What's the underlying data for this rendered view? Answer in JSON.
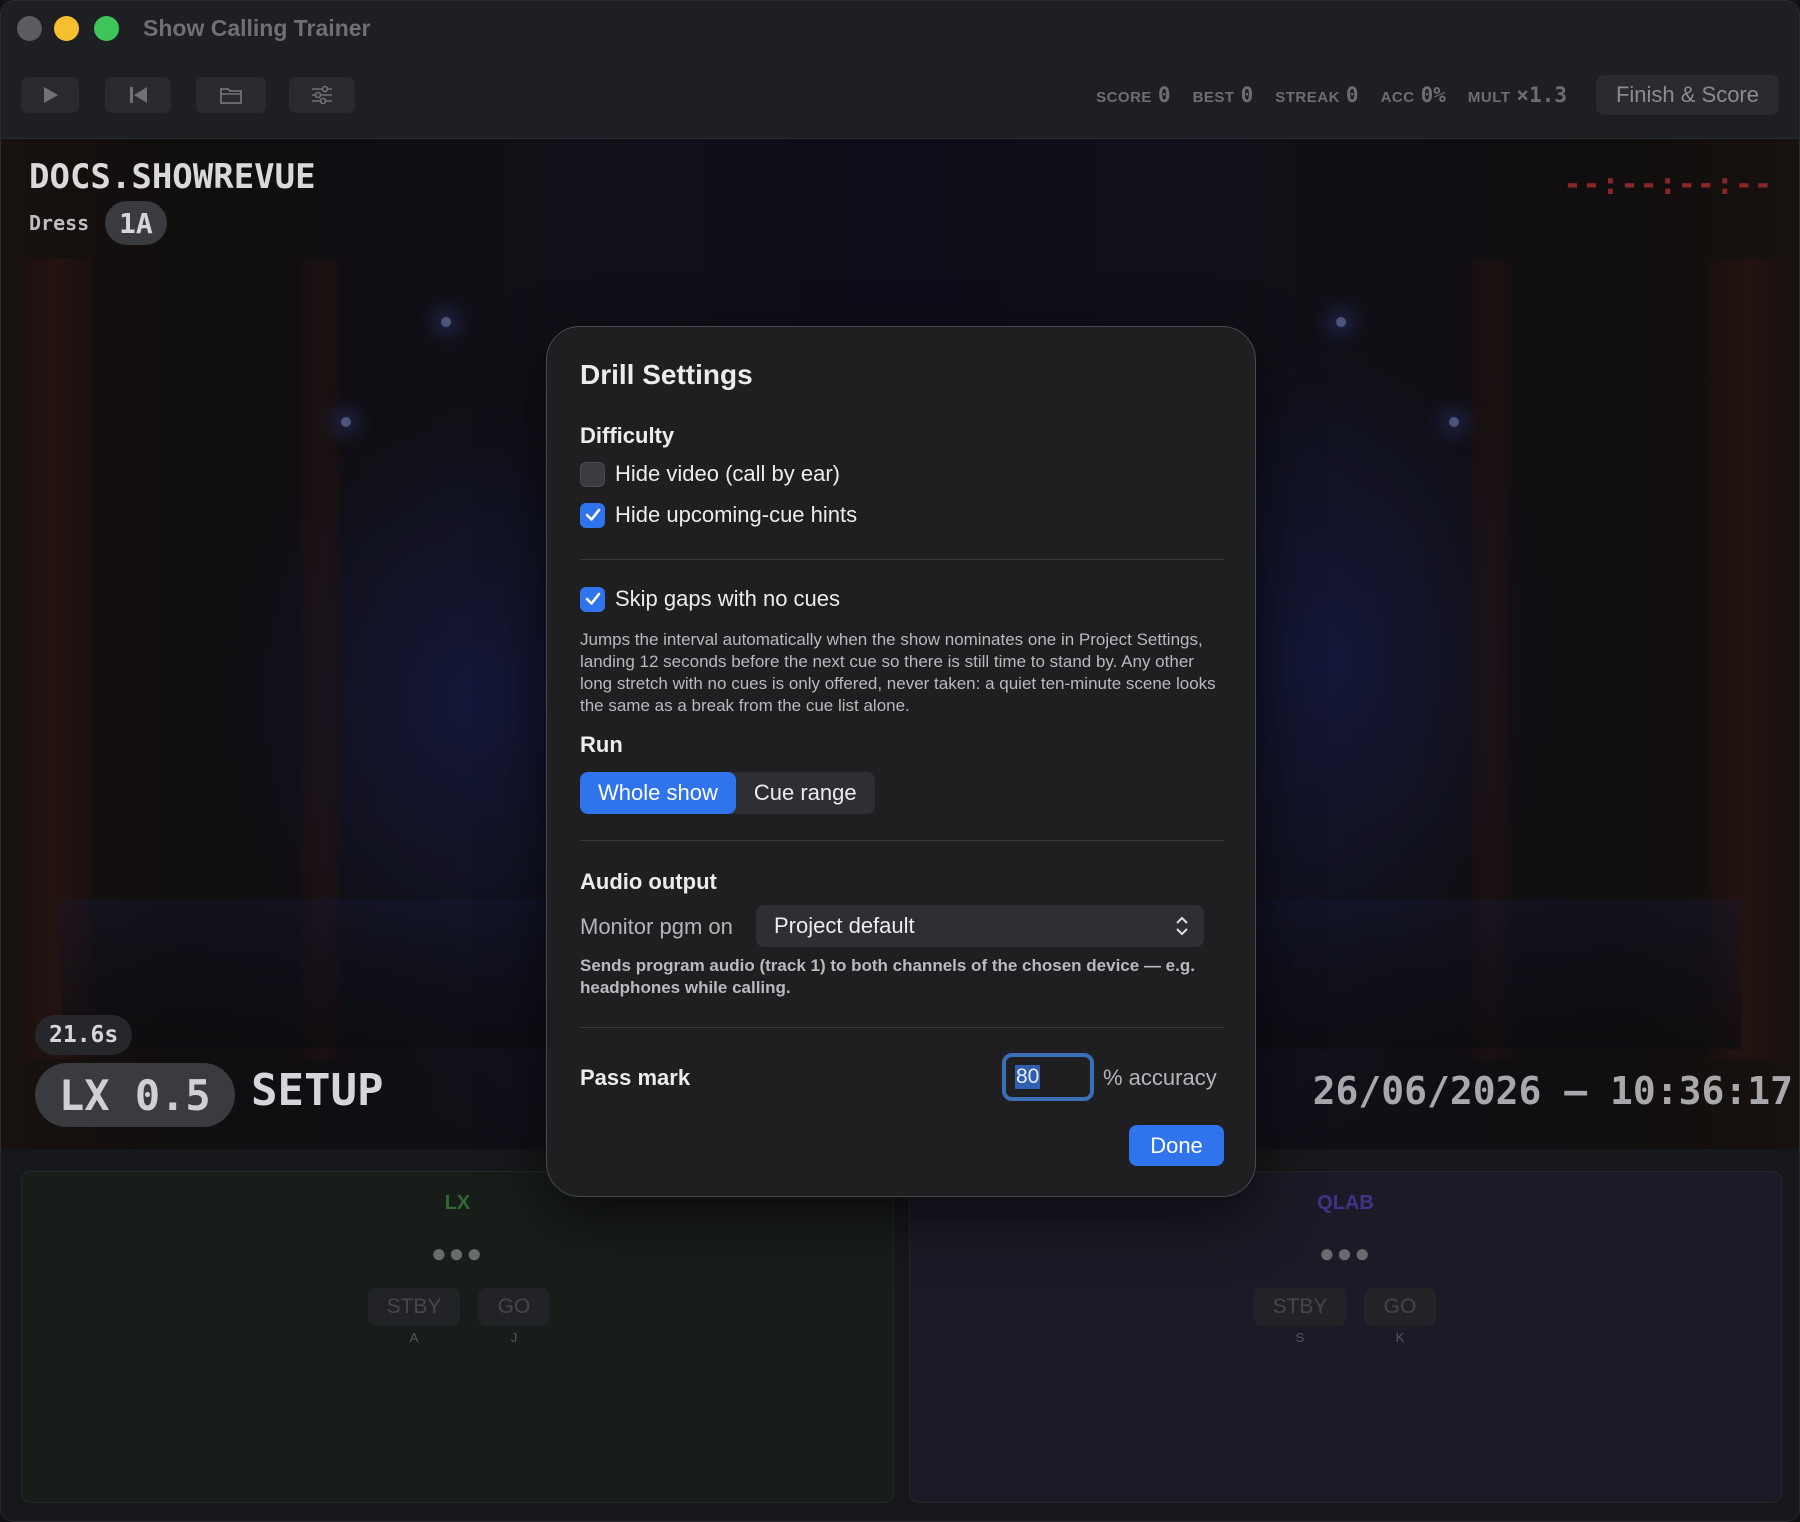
{
  "window": {
    "title": "Show Calling Trainer"
  },
  "toolbar": {
    "buttons": [
      "play-icon",
      "skip-back-icon",
      "folder-icon",
      "sliders-icon"
    ],
    "stats": [
      {
        "label": "SCORE",
        "value": "0"
      },
      {
        "label": "BEST",
        "value": "0"
      },
      {
        "label": "STREAK",
        "value": "0"
      },
      {
        "label": "ACC",
        "value": "0%"
      },
      {
        "label": "MULT",
        "value": "×1.3"
      }
    ],
    "finish_label": "Finish & Score"
  },
  "stage": {
    "show_name": "DOCS.SHOWREVUE",
    "run_type": "Dress",
    "scene": "1A",
    "timecode": "--:--:--:--",
    "elapsed": "21.6s",
    "current_cue": "LX 0.5",
    "cue_name": "SETUP",
    "clock": "26/06/2026 – 10:36:17"
  },
  "panels": [
    {
      "title": "LX",
      "dots": "●●●",
      "stby": "STBY",
      "go": "GO",
      "stby_key": "A",
      "go_key": "J"
    },
    {
      "title": "QLAB",
      "dots": "●●●",
      "stby": "STBY",
      "go": "GO",
      "stby_key": "S",
      "go_key": "K"
    }
  ],
  "modal": {
    "title": "Drill Settings",
    "difficulty_heading": "Difficulty",
    "hide_video": {
      "label": "Hide video (call by ear)",
      "checked": false
    },
    "hide_hints": {
      "label": "Hide upcoming-cue hints",
      "checked": true
    },
    "skip_gaps": {
      "label": "Skip gaps with no cues",
      "checked": true
    },
    "skip_gaps_help": "Jumps the interval automatically when the show nominates one in Project Settings, landing 12 seconds before the next cue so there is still time to stand by. Any other long stretch with no cues is only offered, never taken: a quiet ten-minute scene looks the same as a break from the cue list alone.",
    "run_heading": "Run",
    "run_options": [
      "Whole show",
      "Cue range"
    ],
    "run_selected": "Whole show",
    "audio_heading": "Audio output",
    "monitor_label": "Monitor pgm on",
    "monitor_value": "Project default",
    "audio_help": "Sends program audio (track 1) to both channels of the chosen device — e.g. headphones while calling.",
    "pass_label": "Pass mark",
    "pass_value": "80",
    "pass_suffix": "% accuracy",
    "done_label": "Done"
  },
  "colors": {
    "accent": "#2f74ec",
    "lx": "#2f6a34",
    "qlab": "#3f338a"
  }
}
